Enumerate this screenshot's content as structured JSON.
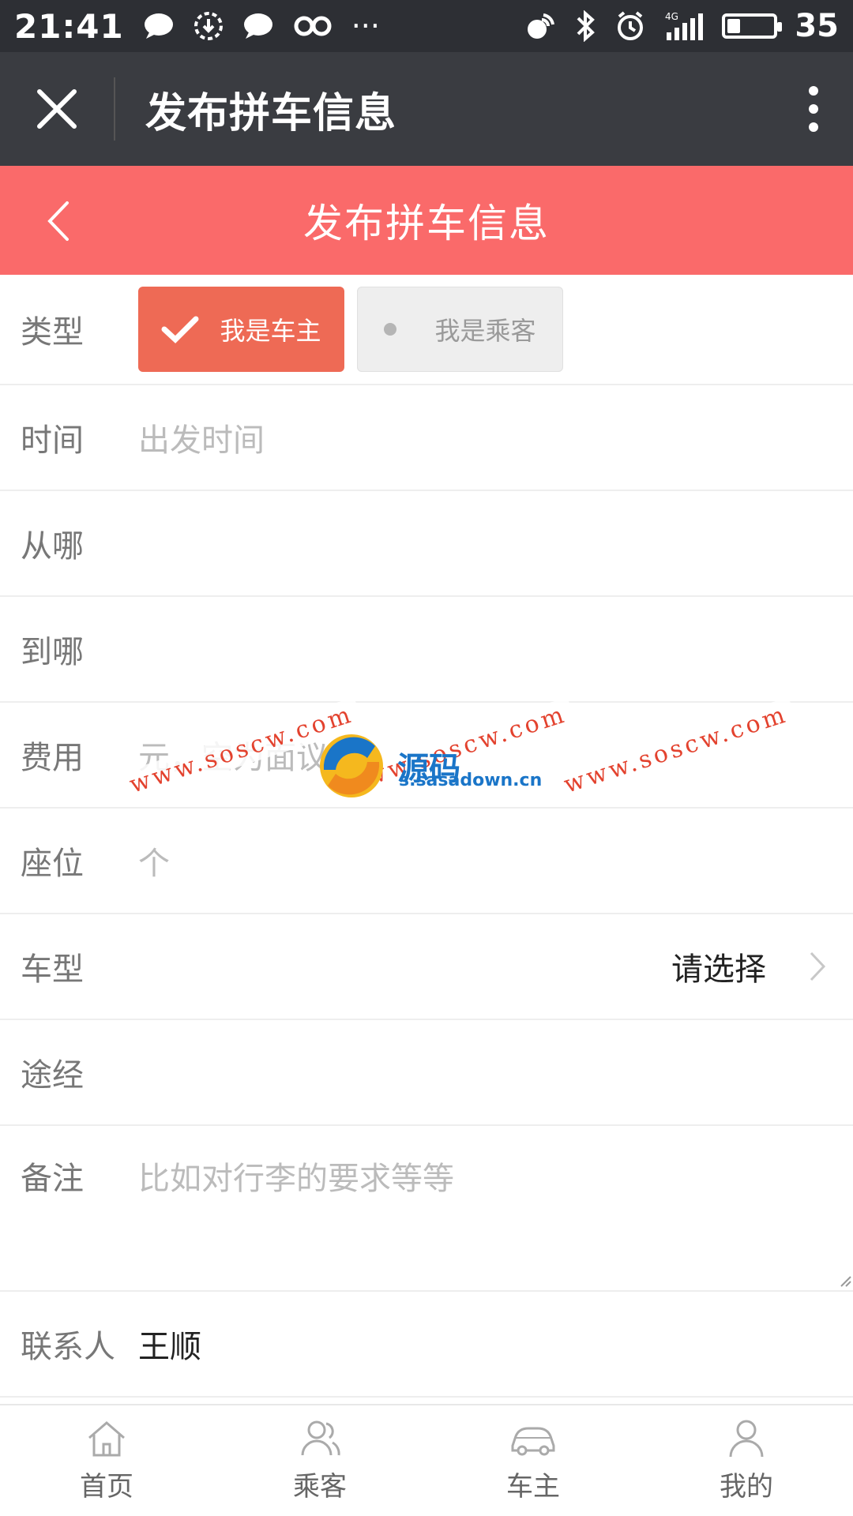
{
  "status_bar": {
    "time": "21:41",
    "battery": "35",
    "battery_level": 0.35,
    "icons_left": [
      "chat-bubble-icon",
      "download-icon",
      "chat-bubble-icon",
      "infinity-icon",
      "more-dots-icon"
    ],
    "icons_right": [
      "nfc-icon",
      "bluetooth-icon",
      "alarm-icon",
      "signal-4g-icon"
    ],
    "more": "···"
  },
  "app_bar": {
    "title": "发布拼车信息"
  },
  "page_header": {
    "title": "发布拼车信息"
  },
  "form": {
    "type": {
      "label": "类型",
      "options": [
        "我是车主",
        "我是乘客"
      ],
      "selected": "我是车主"
    },
    "time": {
      "label": "时间",
      "placeholder": "出发时间"
    },
    "from": {
      "label": "从哪",
      "placeholder": ""
    },
    "to": {
      "label": "到哪",
      "placeholder": ""
    },
    "fee": {
      "label": "费用",
      "placeholder": "元，空为面议"
    },
    "seats": {
      "label": "座位",
      "placeholder": "个"
    },
    "car_type": {
      "label": "车型",
      "value": "请选择"
    },
    "via": {
      "label": "途经",
      "placeholder": ""
    },
    "remarks": {
      "label": "备注",
      "placeholder": "比如对行李的要求等等"
    },
    "contact": {
      "label": "联系人",
      "value": "王顺"
    }
  },
  "watermark": {
    "text": "www.soscw.com",
    "brand": "源码",
    "domain": "s.sasadown.cn"
  },
  "tabbar": {
    "items": [
      {
        "label": "首页",
        "icon": "home-icon"
      },
      {
        "label": "乘客",
        "icon": "passenger-icon"
      },
      {
        "label": "车主",
        "icon": "car-icon"
      },
      {
        "label": "我的",
        "icon": "profile-icon"
      }
    ]
  },
  "colors": {
    "status_bar": "#2d2f34",
    "app_bar": "#3a3c41",
    "header": "#fa6a6a",
    "active_type": "#ee6a55"
  }
}
